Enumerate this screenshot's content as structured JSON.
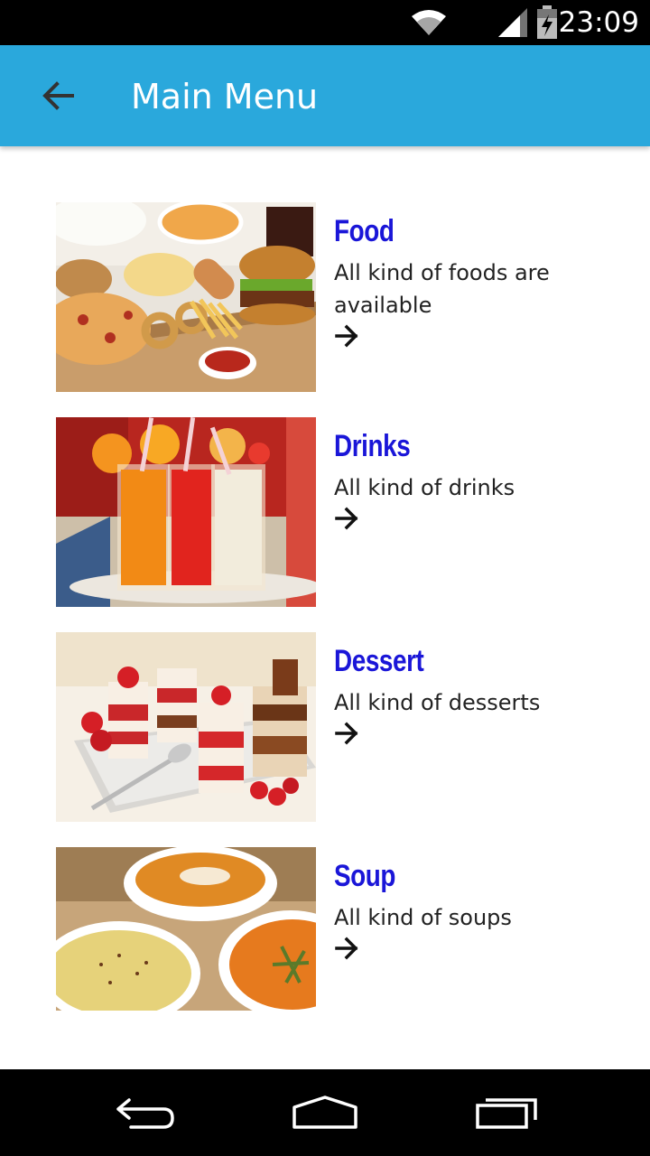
{
  "status_bar": {
    "time": "23:09",
    "icons": [
      "wifi-icon",
      "signal-icon",
      "battery-charging-icon"
    ]
  },
  "app_bar": {
    "title": "Main Menu",
    "back_icon": "arrow-back-icon",
    "background": "#2aa8dc"
  },
  "menu": {
    "items": [
      {
        "title": "Food",
        "description": "All kind of foods are available",
        "image": "fast-food-platter-image",
        "arrow_icon": "arrow-right-icon"
      },
      {
        "title": "Drinks",
        "description": "All kind of drinks",
        "image": "juice-glasses-image",
        "arrow_icon": "arrow-right-icon"
      },
      {
        "title": "Dessert",
        "description": "All kind of desserts",
        "image": "dessert-cups-image",
        "arrow_icon": "arrow-right-icon"
      },
      {
        "title": "Soup",
        "description": "All kind of soups",
        "image": "soup-bowls-image",
        "arrow_icon": "arrow-right-icon"
      }
    ],
    "title_color": "#1a16d8"
  },
  "nav_bar": {
    "buttons": [
      "back-nav-icon",
      "home-nav-icon",
      "recents-nav-icon"
    ]
  }
}
